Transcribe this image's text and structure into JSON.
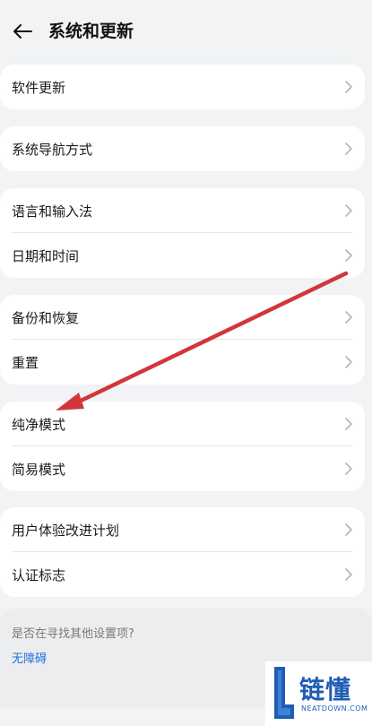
{
  "header": {
    "back_icon": "arrow-left-icon",
    "title": "系统和更新"
  },
  "groups": [
    {
      "items": [
        {
          "label": "软件更新"
        }
      ]
    },
    {
      "items": [
        {
          "label": "系统导航方式"
        }
      ]
    },
    {
      "items": [
        {
          "label": "语言和输入法"
        },
        {
          "label": "日期和时间"
        }
      ]
    },
    {
      "items": [
        {
          "label": "备份和恢复"
        },
        {
          "label": "重置"
        }
      ]
    },
    {
      "items": [
        {
          "label": "纯净模式"
        },
        {
          "label": "简易模式"
        }
      ]
    },
    {
      "items": [
        {
          "label": "用户体验改进计划"
        },
        {
          "label": "认证标志"
        }
      ]
    }
  ],
  "search_prompt": {
    "question": "是否在寻找其他设置项?",
    "link": "无障碍"
  },
  "watermark": {
    "text": "链懂",
    "subtext": "NEATDOWN.COM"
  },
  "annotation": {
    "color": "#d1373a",
    "icon": "red-arrow-annotation"
  },
  "colors": {
    "background": "#f1f3f5",
    "card": "#ffffff",
    "link": "#1f6fe0",
    "chevron": "#b5b5b5"
  }
}
